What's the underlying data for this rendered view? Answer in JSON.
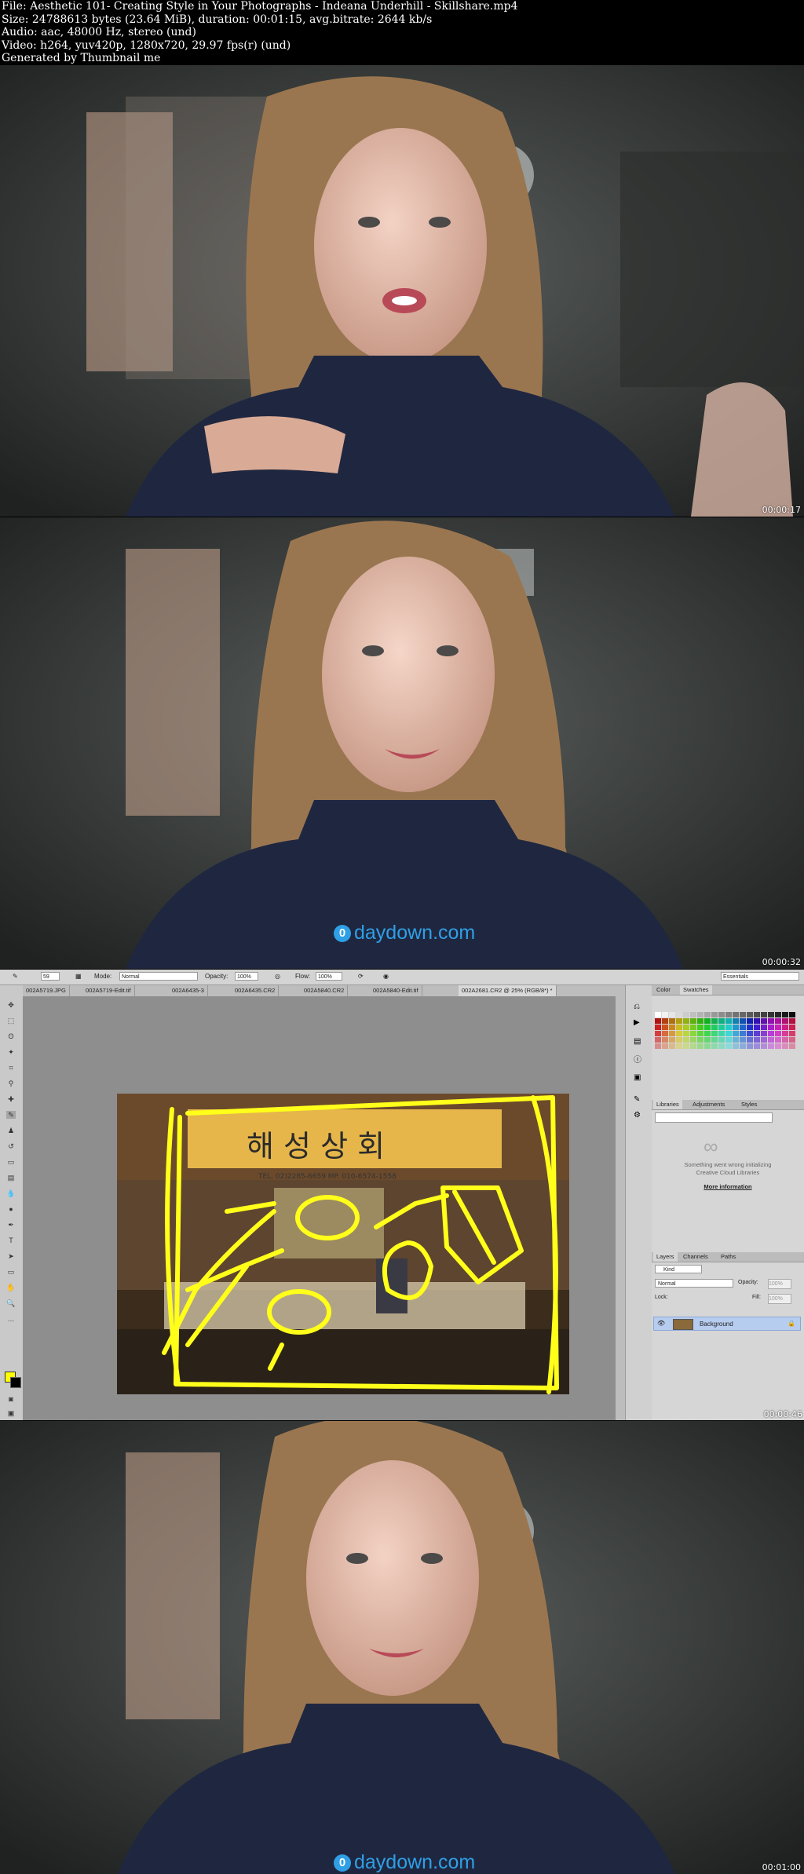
{
  "header": {
    "line1": "File: Aesthetic 101- Creating Style in Your Photographs - Indeana Underhill - Skillshare.mp4",
    "line2": "Size: 24788613 bytes (23.64 MiB), duration: 00:01:15, avg.bitrate: 2644 kb/s",
    "line3": "Audio: aac, 48000 Hz, stereo (und)",
    "line4": "Video: h264, yuv420p, 1280x720, 29.97 fps(r) (und)",
    "line5": "Generated by Thumbnail me"
  },
  "frames": [
    {
      "timestamp": "00:00:17"
    },
    {
      "timestamp": "00:00:32",
      "watermark": "daydown.com"
    },
    {
      "timestamp": "00:00:46"
    },
    {
      "timestamp": "00:01:00",
      "watermark": "daydown.com"
    }
  ],
  "photoshop": {
    "options": {
      "brush_size": "59",
      "mode_label": "Mode:",
      "mode_value": "Normal",
      "opacity_label": "Opacity:",
      "opacity_value": "100%",
      "flow_label": "Flow:",
      "flow_value": "100%",
      "workspace": "Essentials"
    },
    "tabs": [
      {
        "label": "002A5719.JPG"
      },
      {
        "label": "002A5719-Edit.tif"
      },
      {
        "label": "002A6435-3"
      },
      {
        "label": "002A6435.CR2"
      },
      {
        "label": "002A5840.CR2"
      },
      {
        "label": "002A5840-Edit.tif"
      },
      {
        "label": "002A2681.CR2 @ 25% (RGB/8*) *"
      }
    ],
    "panel_color": {
      "tab1": "Color",
      "tab2": "Swatches"
    },
    "panel_libraries": {
      "tab1": "Libraries",
      "tab2": "Adjustments",
      "tab3": "Styles",
      "msg1": "Something went wrong initializing",
      "msg2": "Creative Cloud Libraries",
      "link": "More information"
    },
    "panel_layers": {
      "tab1": "Layers",
      "tab2": "Channels",
      "tab3": "Paths",
      "kind": "Kind",
      "blend": "Normal",
      "opacity_label": "Opacity:",
      "opacity_value": "100%",
      "lock_label": "Lock:",
      "fill_label": "Fill:",
      "fill_value": "100%",
      "layer_name": "Background"
    },
    "sign_text": "해 성 상 회",
    "sign_tel": "TEL. 02)2285-6659    MP. 010-6574-1558"
  },
  "colors": {
    "watermark": "#2f9fe6",
    "annotation": "#ffff1a",
    "foreground": "#ffff00"
  }
}
